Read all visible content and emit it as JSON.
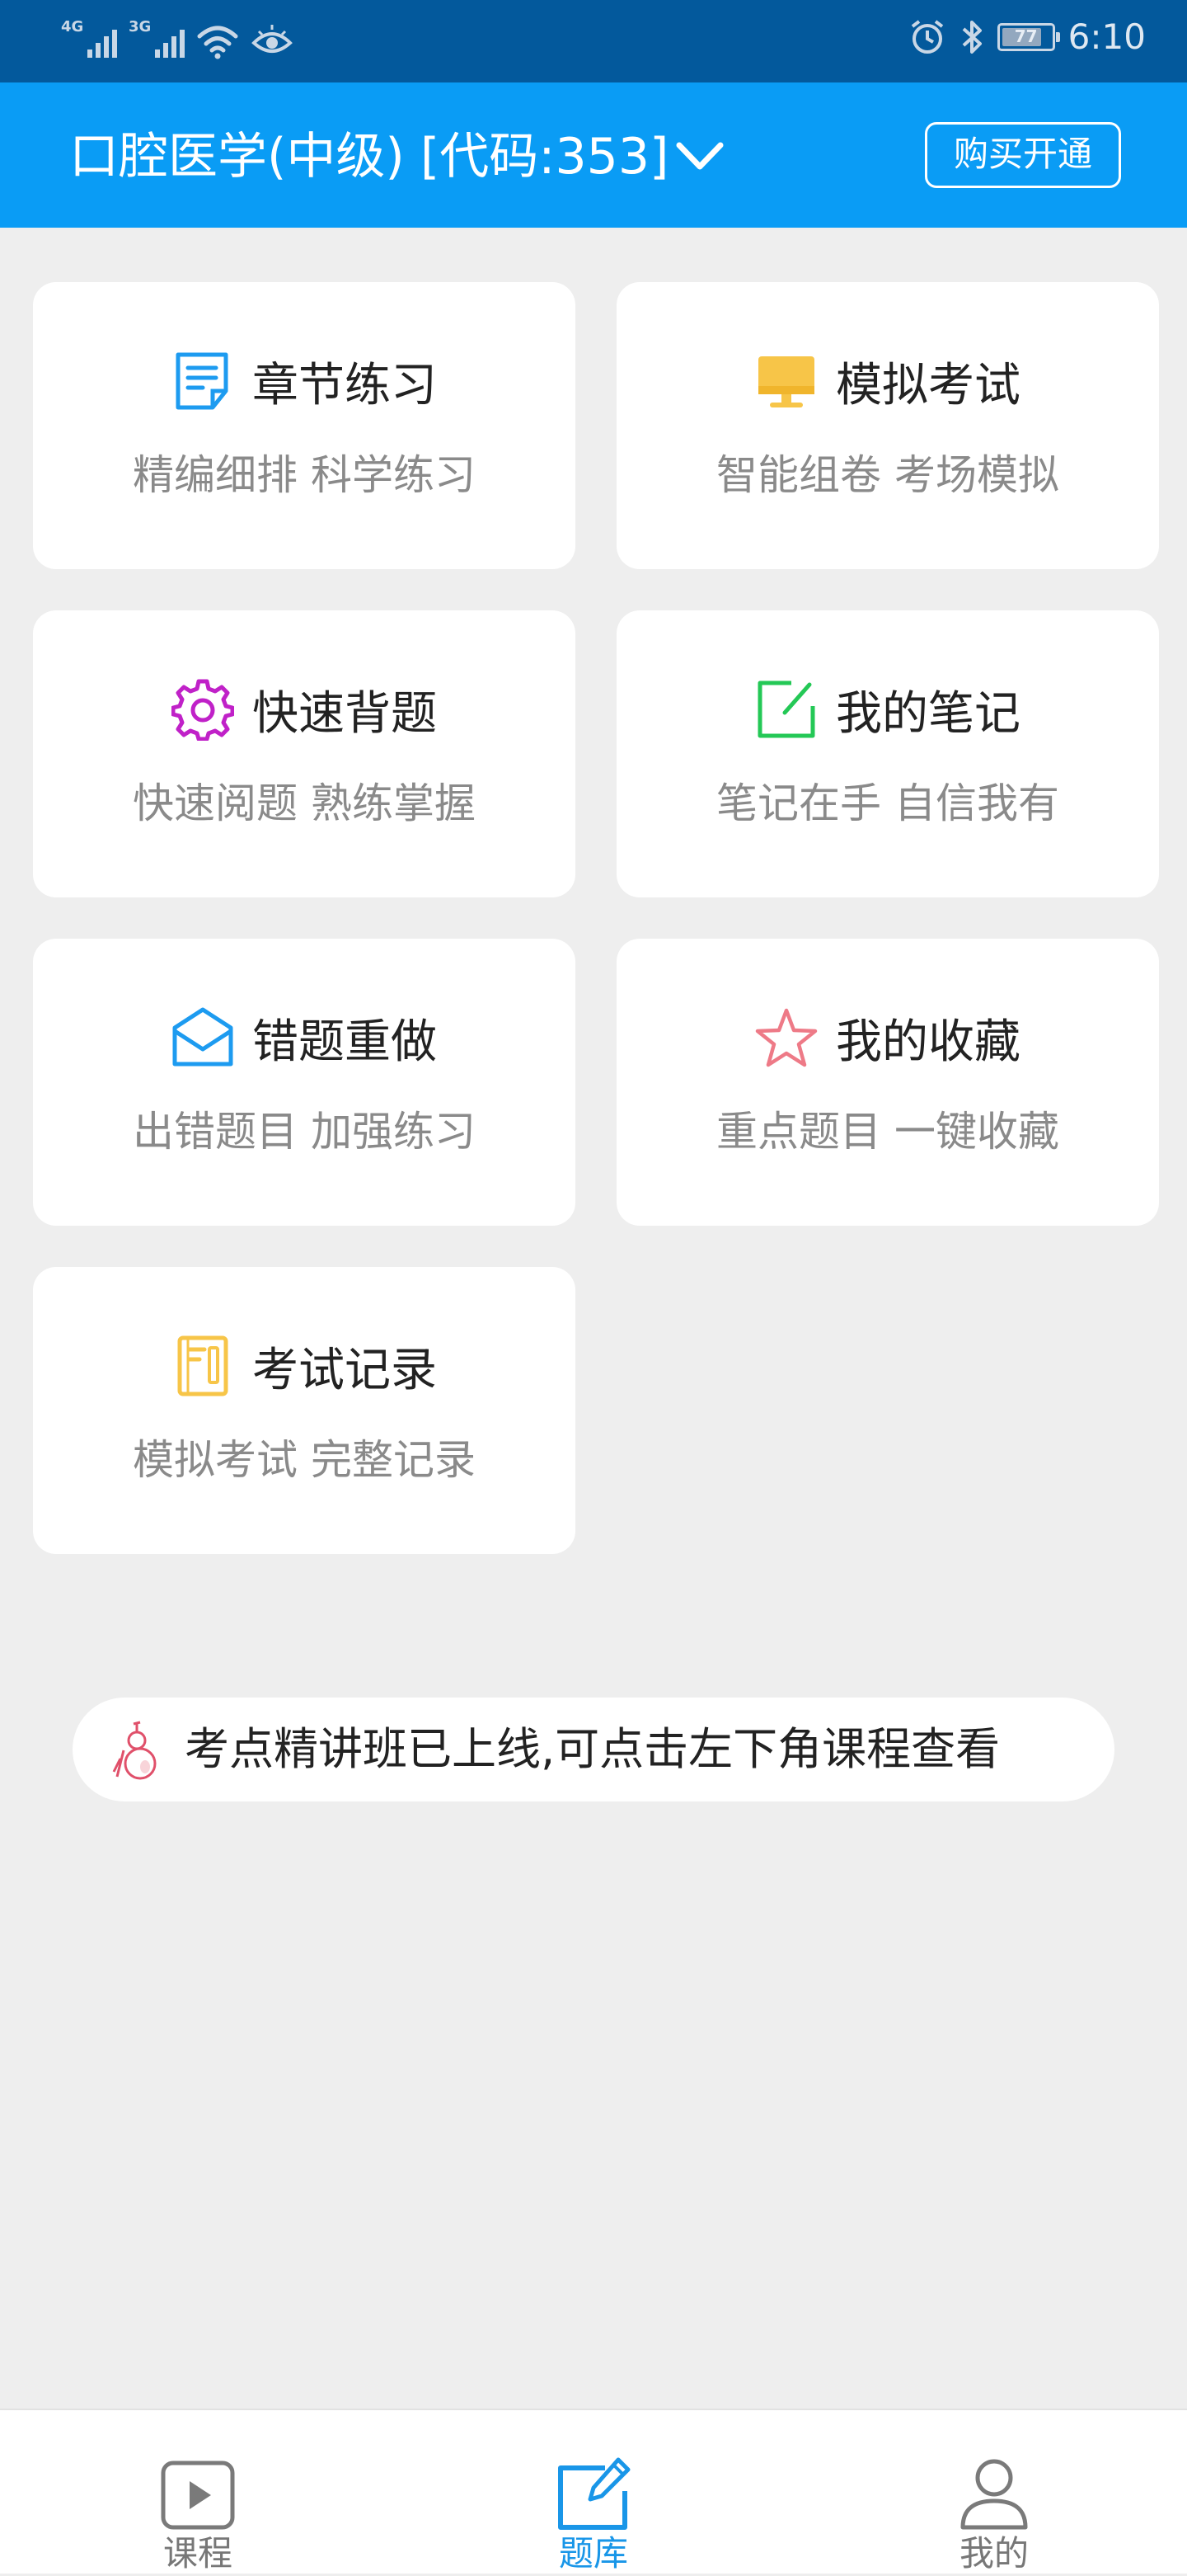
{
  "status_bar": {
    "network_1": "4G",
    "network_2": "3G",
    "battery": "77",
    "time": "6:10"
  },
  "header": {
    "title": "口腔医学(中级) [代码:353]",
    "buy_label": "购买开通",
    "bg_color": "#0a9cf5"
  },
  "menu": [
    {
      "title": "章节练习",
      "subtitle": "精编细排 科学练习",
      "icon": "document-icon",
      "color": "#1d9bf0"
    },
    {
      "title": "模拟考试",
      "subtitle": "智能组卷 考场模拟",
      "icon": "monitor-icon",
      "color": "#f7c548"
    },
    {
      "title": "快速背题",
      "subtitle": "快速阅题 熟练掌握",
      "icon": "gear-icon",
      "color": "#c021c8"
    },
    {
      "title": "我的笔记",
      "subtitle": "笔记在手 自信我有",
      "icon": "edit-note-icon",
      "color": "#24c856"
    },
    {
      "title": "错题重做",
      "subtitle": "出错题目 加强练习",
      "icon": "envelope-icon",
      "color": "#1d9bf0"
    },
    {
      "title": "我的收藏",
      "subtitle": "重点题目 一键收藏",
      "icon": "star-icon",
      "color": "#ee7a87"
    },
    {
      "title": "考试记录",
      "subtitle": "模拟考试 完整记录",
      "icon": "notebook-icon",
      "color": "#f7c548"
    }
  ],
  "notice": {
    "text": "考点精讲班已上线,可点击左下角课程查看",
    "icon": "gourd-icon"
  },
  "bottom_nav": [
    {
      "label": "课程",
      "icon": "play-icon"
    },
    {
      "label": "题库",
      "icon": "question-bank-icon",
      "active": true
    },
    {
      "label": "我的",
      "icon": "profile-icon"
    }
  ]
}
